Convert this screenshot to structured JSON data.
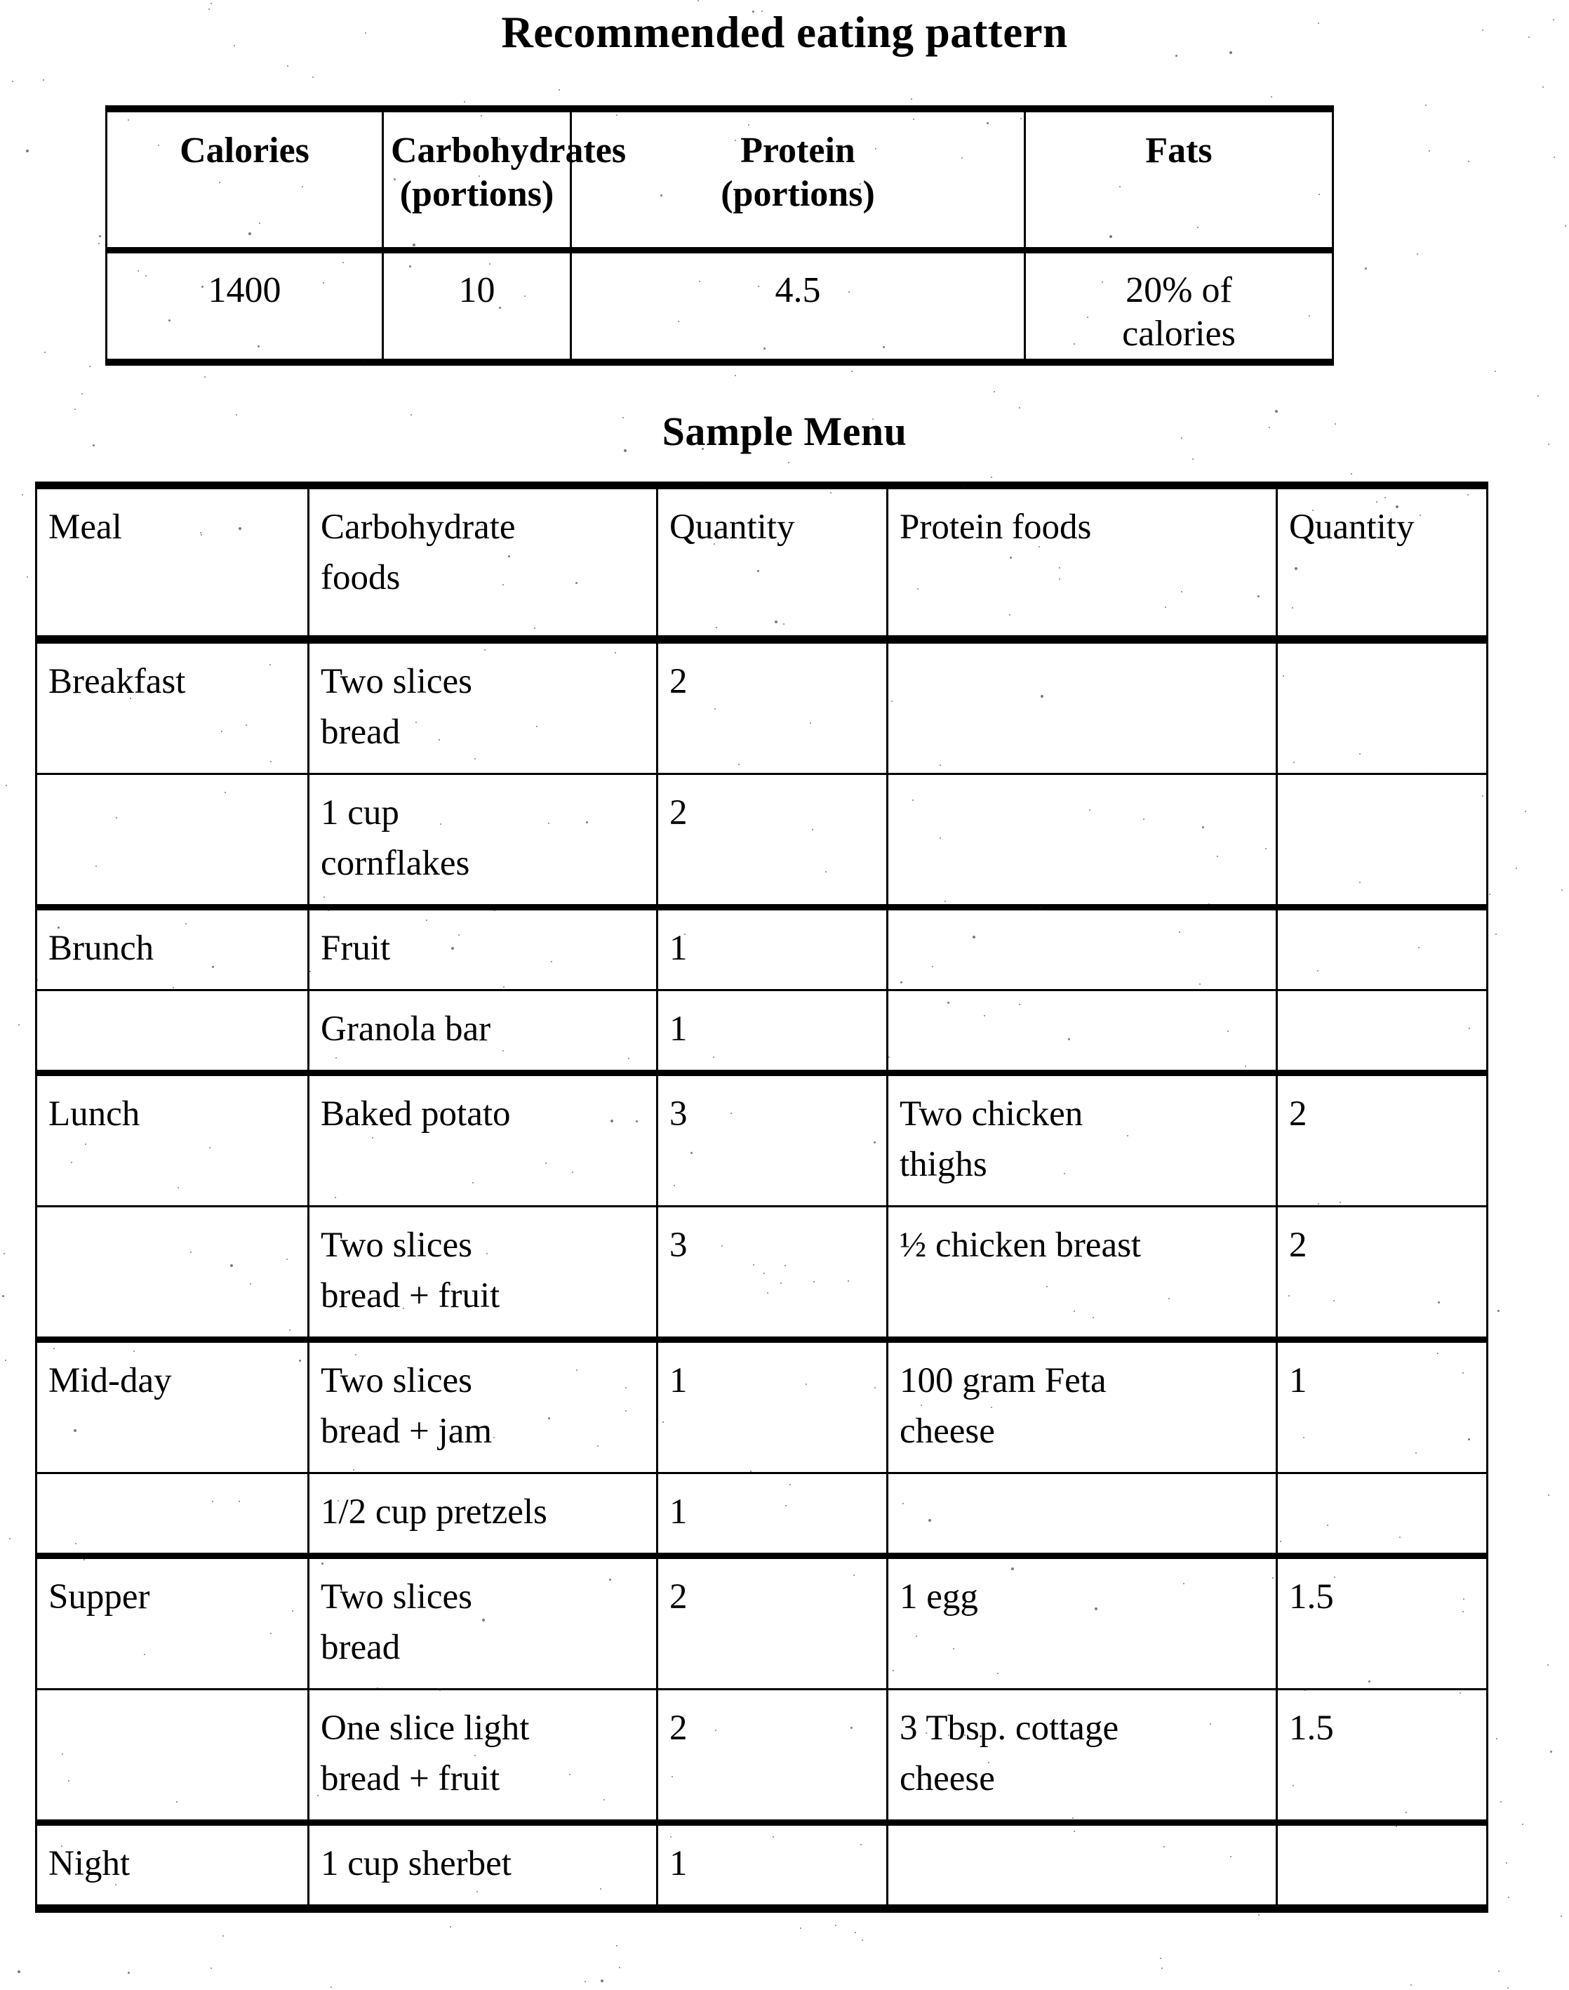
{
  "document": {
    "title_main": "Recommended eating pattern",
    "title_sample": "Sample Menu"
  },
  "eating_pattern_table": {
    "headers": [
      "Calories",
      "Carbohydrates (portions)",
      "Protein (portions)",
      "Fats"
    ],
    "headers_lines": [
      [
        "Calories"
      ],
      [
        "Carbohydrates",
        "(portions)"
      ],
      [
        "Protein",
        "(portions)"
      ],
      [
        "Fats"
      ]
    ],
    "rows": [
      {
        "calories": "1400",
        "carbohydrates": "10",
        "protein": "4.5",
        "fats_line1": "20% of",
        "fats_line2": "calories"
      }
    ]
  },
  "sample_menu_table": {
    "headers": {
      "meal": "Meal",
      "carb_foods_line1": "Carbohydrate",
      "carb_foods_line2": "foods",
      "carb_quantity": "Quantity",
      "protein_foods": "Protein foods",
      "protein_quantity": "Quantity"
    },
    "rows": [
      {
        "meal": "Breakfast",
        "carb_line1": "Two slices",
        "carb_line2": "bread",
        "carb_qty": "2",
        "protein_line1": "",
        "protein_line2": "",
        "protein_qty": ""
      },
      {
        "meal": "",
        "carb_line1": "1 cup",
        "carb_line2": "cornflakes",
        "carb_qty": "2",
        "protein_line1": "",
        "protein_line2": "",
        "protein_qty": ""
      },
      {
        "meal": "Brunch",
        "carb_line1": "Fruit",
        "carb_line2": "",
        "carb_qty": "1",
        "protein_line1": "",
        "protein_line2": "",
        "protein_qty": ""
      },
      {
        "meal": "",
        "carb_line1": "Granola bar",
        "carb_line2": "",
        "carb_qty": "1",
        "protein_line1": "",
        "protein_line2": "",
        "protein_qty": ""
      },
      {
        "meal": "Lunch",
        "carb_line1": "Baked potato",
        "carb_line2": "",
        "carb_qty": "3",
        "protein_line1": "Two chicken",
        "protein_line2": "thighs",
        "protein_qty": "2"
      },
      {
        "meal": "",
        "carb_line1": "Two slices",
        "carb_line2": "bread + fruit",
        "carb_qty": "3",
        "protein_line1": "½ chicken breast",
        "protein_line2": "",
        "protein_qty": "2"
      },
      {
        "meal": "Mid-day",
        "carb_line1": "Two slices",
        "carb_line2": "bread + jam",
        "carb_qty": "1",
        "protein_line1": "100 gram Feta",
        "protein_line2": "cheese",
        "protein_qty": "1"
      },
      {
        "meal": "",
        "carb_line1": "1/2 cup pretzels",
        "carb_line2": "",
        "carb_qty": "1",
        "protein_line1": "",
        "protein_line2": "",
        "protein_qty": ""
      },
      {
        "meal": "Supper",
        "carb_line1": "Two slices",
        "carb_line2": "bread",
        "carb_qty": "2",
        "protein_line1": "1 egg",
        "protein_line2": "",
        "protein_qty": "1.5"
      },
      {
        "meal": "",
        "carb_line1": "One slice light",
        "carb_line2": "bread + fruit",
        "carb_qty": "2",
        "protein_line1": "3 Tbsp. cottage",
        "protein_line2": "cheese",
        "protein_qty": "1.5"
      },
      {
        "meal": "Night",
        "carb_line1": "1 cup sherbet",
        "carb_line2": "",
        "carb_qty": "1",
        "protein_line1": "",
        "protein_line2": "",
        "protein_qty": ""
      }
    ],
    "meal_start_row_indices": [
      0,
      2,
      4,
      6,
      8,
      10
    ]
  },
  "style": {
    "ink_color": "#000000",
    "paper_color": "#ffffff"
  }
}
